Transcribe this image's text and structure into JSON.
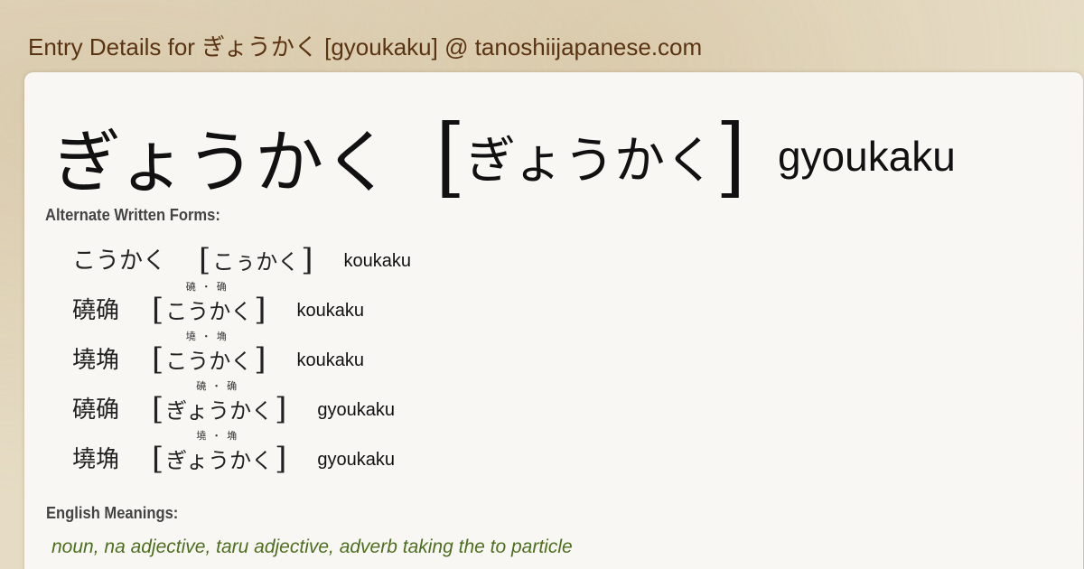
{
  "header": {
    "title": "Entry Details for ぎょうかく [gyoukaku] @ tanoshiijapanese.com"
  },
  "entry": {
    "written": "ぎょうかく",
    "bracket_open": "[",
    "reading": "ぎょうかく",
    "bracket_close": "]",
    "romaji": "gyoukaku"
  },
  "alternate": {
    "label": "Alternate Written Forms:",
    "forms": [
      {
        "written": "こうかく",
        "ruby": "",
        "reading": "こぅかく",
        "romaji": "koukaku"
      },
      {
        "written": "磽确",
        "ruby": "磽・确",
        "reading": "こうかく",
        "romaji": "koukaku"
      },
      {
        "written": "墝埆",
        "ruby": "墝・埆",
        "reading": "こうかく",
        "romaji": "koukaku"
      },
      {
        "written": "磽确",
        "ruby": "磽・确",
        "reading": "ぎょうかく",
        "romaji": "gyoukaku"
      },
      {
        "written": "墝埆",
        "ruby": "墝・埆",
        "reading": "ぎょうかく",
        "romaji": "gyoukaku"
      }
    ]
  },
  "meanings": {
    "label": "English Meanings:",
    "pos": "noun, na adjective, taru adjective, adverb taking the to particle"
  },
  "colors": {
    "header": "#5a3312",
    "meanings": "#4d6e1f",
    "card": "#f8f7f3"
  }
}
